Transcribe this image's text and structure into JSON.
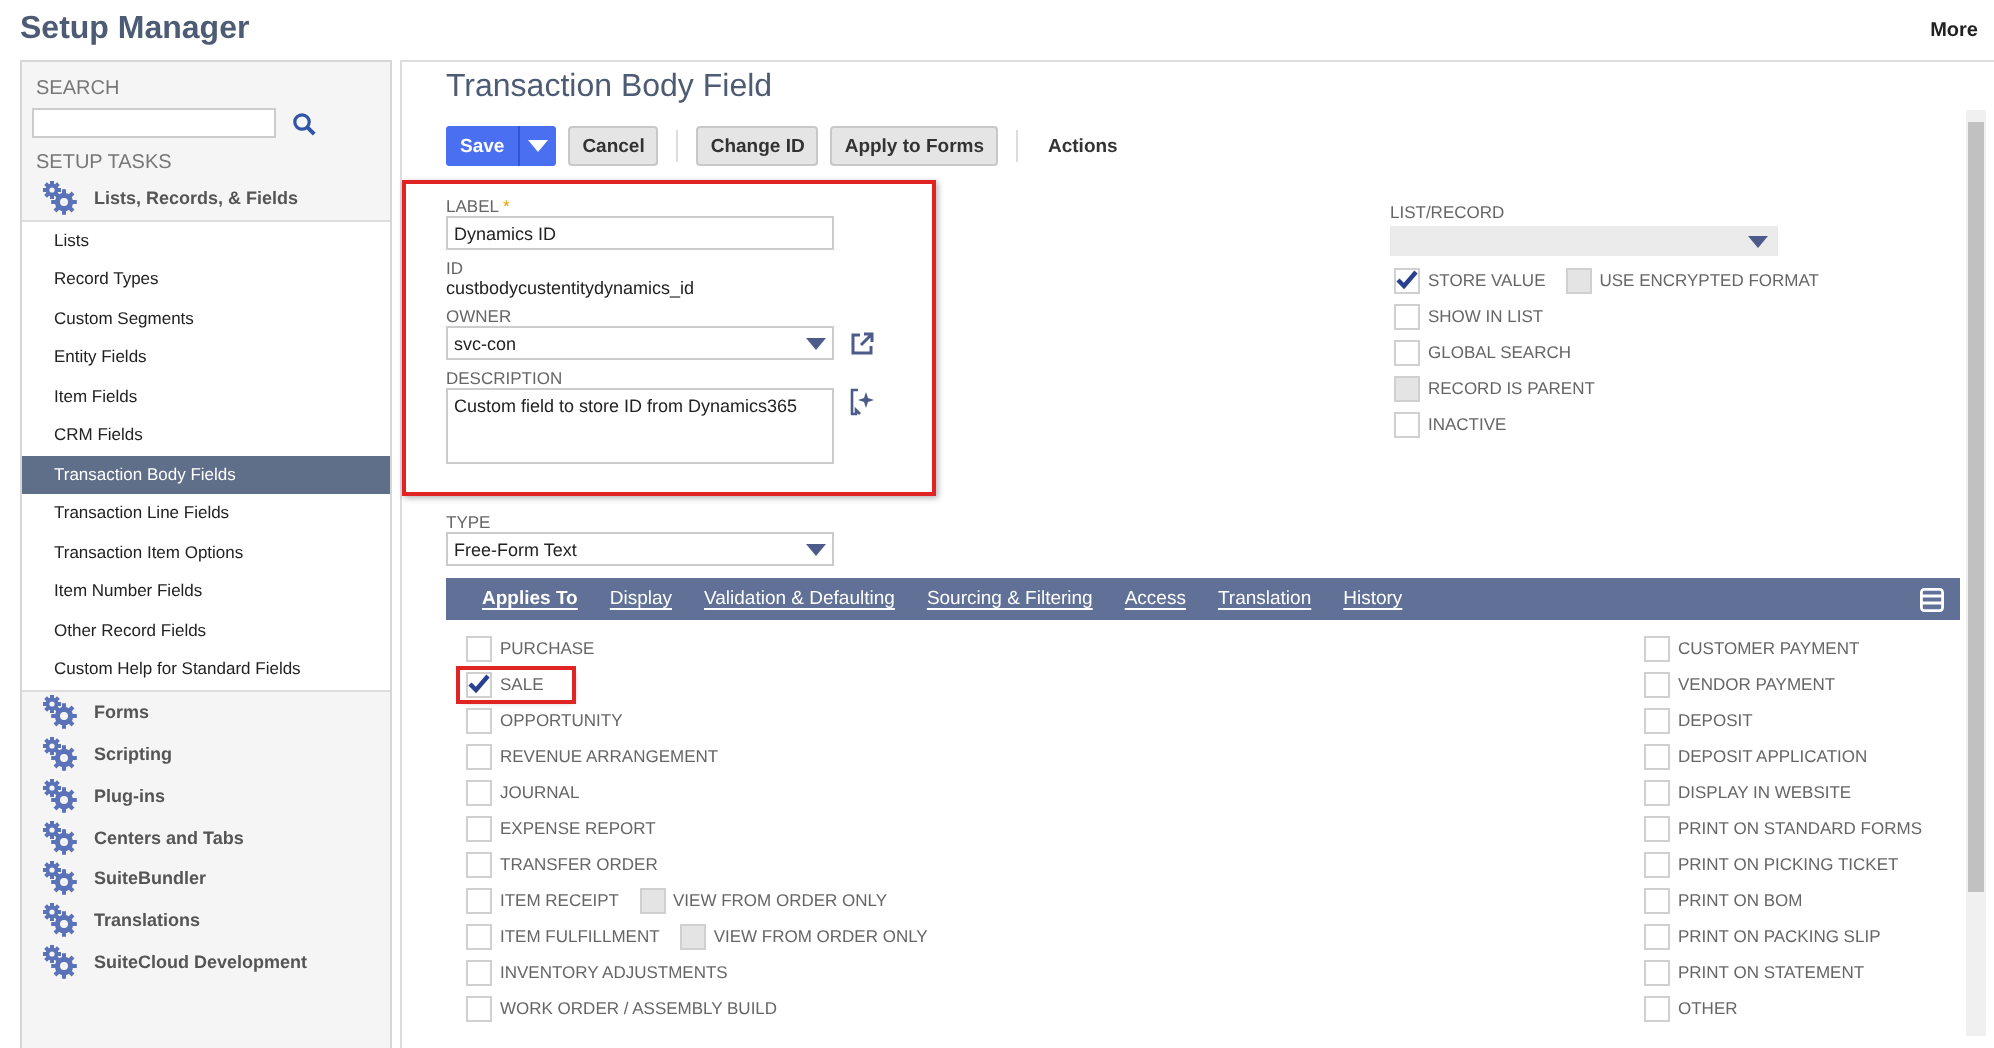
{
  "header": {
    "title": "Setup Manager",
    "more": "More"
  },
  "sidebar": {
    "search_label": "SEARCH",
    "tasks_label": "SETUP TASKS",
    "groups": [
      {
        "label": "Lists, Records, & Fields",
        "items": [
          {
            "label": "Lists",
            "selected": false
          },
          {
            "label": "Record Types",
            "selected": false
          },
          {
            "label": "Custom Segments",
            "selected": false
          },
          {
            "label": "Entity Fields",
            "selected": false
          },
          {
            "label": "Item Fields",
            "selected": false
          },
          {
            "label": "CRM Fields",
            "selected": false
          },
          {
            "label": "Transaction Body Fields",
            "selected": true
          },
          {
            "label": "Transaction Line Fields",
            "selected": false
          },
          {
            "label": "Transaction Item Options",
            "selected": false
          },
          {
            "label": "Item Number Fields",
            "selected": false
          },
          {
            "label": "Other Record Fields",
            "selected": false
          },
          {
            "label": "Custom Help for Standard Fields",
            "selected": false
          }
        ]
      },
      {
        "label": "Forms"
      },
      {
        "label": "Scripting"
      },
      {
        "label": "Plug-ins"
      },
      {
        "label": "Centers and Tabs"
      },
      {
        "label": "SuiteBundler"
      },
      {
        "label": "Translations"
      },
      {
        "label": "SuiteCloud Development"
      }
    ]
  },
  "page": {
    "title": "Transaction Body Field",
    "toolbar": [
      {
        "kind": "primary",
        "label": "Save"
      },
      {
        "kind": "plain",
        "label": "Cancel"
      },
      {
        "kind": "separator"
      },
      {
        "kind": "plain",
        "label": "Change ID"
      },
      {
        "kind": "plain",
        "label": "Apply to Forms"
      },
      {
        "kind": "separator"
      },
      {
        "kind": "menu",
        "label": "Actions"
      }
    ],
    "form": {
      "highlighted": true,
      "label": {
        "caption": "LABEL",
        "required_mark": "*",
        "value": "Dynamics ID"
      },
      "id": {
        "caption": "ID",
        "value": "custbodycustentitydynamics_id"
      },
      "owner": {
        "caption": "OWNER",
        "value": "svc-con"
      },
      "description": {
        "caption": "DESCRIPTION",
        "value": "Custom field to store ID from Dynamics365"
      }
    },
    "type": {
      "caption": "TYPE",
      "value": "Free-Form Text"
    },
    "list_record": {
      "caption": "LIST/RECORD"
    },
    "options": [
      [
        {
          "label": "STORE VALUE",
          "checked": true,
          "disabled": false
        },
        {
          "label": "USE ENCRYPTED FORMAT",
          "checked": false,
          "disabled": true
        }
      ],
      [
        {
          "label": "SHOW IN LIST",
          "checked": false,
          "disabled": false
        }
      ],
      [
        {
          "label": "GLOBAL SEARCH",
          "checked": false,
          "disabled": false
        }
      ],
      [
        {
          "label": "RECORD IS PARENT",
          "checked": false,
          "disabled": true
        }
      ],
      [
        {
          "label": "INACTIVE",
          "checked": false,
          "disabled": false
        }
      ]
    ],
    "tabs": [
      {
        "label": "Applies To",
        "selected": true
      },
      {
        "label": "Display",
        "selected": false
      },
      {
        "label": "Validation & Defaulting",
        "selected": false
      },
      {
        "label": "Sourcing & Filtering",
        "selected": false
      },
      {
        "label": "Access",
        "selected": false
      },
      {
        "label": "Translation",
        "selected": false
      },
      {
        "label": "History",
        "selected": false
      }
    ],
    "applies_left": [
      [
        {
          "label": "PURCHASE",
          "checked": false,
          "disabled": false,
          "highlighted": false
        }
      ],
      [
        {
          "label": "SALE",
          "checked": true,
          "disabled": false,
          "highlighted": true
        }
      ],
      [
        {
          "label": "OPPORTUNITY",
          "checked": false,
          "disabled": false,
          "highlighted": false
        }
      ],
      [
        {
          "label": "REVENUE ARRANGEMENT",
          "checked": false,
          "disabled": false,
          "highlighted": false
        }
      ],
      [
        {
          "label": "JOURNAL",
          "checked": false,
          "disabled": false,
          "highlighted": false
        }
      ],
      [
        {
          "label": "EXPENSE REPORT",
          "checked": false,
          "disabled": false,
          "highlighted": false
        }
      ],
      [
        {
          "label": "TRANSFER ORDER",
          "checked": false,
          "disabled": false,
          "highlighted": false
        }
      ],
      [
        {
          "label": "ITEM RECEIPT",
          "checked": false,
          "disabled": false,
          "highlighted": false
        },
        {
          "label": "VIEW FROM ORDER ONLY",
          "checked": false,
          "disabled": true,
          "highlighted": false
        }
      ],
      [
        {
          "label": "ITEM FULFILLMENT",
          "checked": false,
          "disabled": false,
          "highlighted": false
        },
        {
          "label": "VIEW FROM ORDER ONLY",
          "checked": false,
          "disabled": true,
          "highlighted": false
        }
      ],
      [
        {
          "label": "INVENTORY ADJUSTMENTS",
          "checked": false,
          "disabled": false,
          "highlighted": false
        }
      ],
      [
        {
          "label": "WORK ORDER / ASSEMBLY BUILD",
          "checked": false,
          "disabled": false,
          "highlighted": false
        }
      ]
    ],
    "applies_right": [
      {
        "label": "CUSTOMER PAYMENT",
        "checked": false,
        "disabled": false
      },
      {
        "label": "VENDOR PAYMENT",
        "checked": false,
        "disabled": false
      },
      {
        "label": "DEPOSIT",
        "checked": false,
        "disabled": false
      },
      {
        "label": "DEPOSIT APPLICATION",
        "checked": false,
        "disabled": false
      },
      {
        "label": "DISPLAY IN WEBSITE",
        "checked": false,
        "disabled": false
      },
      {
        "label": "PRINT ON STANDARD FORMS",
        "checked": false,
        "disabled": false
      },
      {
        "label": "PRINT ON PICKING TICKET",
        "checked": false,
        "disabled": false
      },
      {
        "label": "PRINT ON BOM",
        "checked": false,
        "disabled": false
      },
      {
        "label": "PRINT ON PACKING SLIP",
        "checked": false,
        "disabled": false
      },
      {
        "label": "PRINT ON STATEMENT",
        "checked": false,
        "disabled": false
      },
      {
        "label": "OTHER",
        "checked": false,
        "disabled": false
      }
    ]
  }
}
